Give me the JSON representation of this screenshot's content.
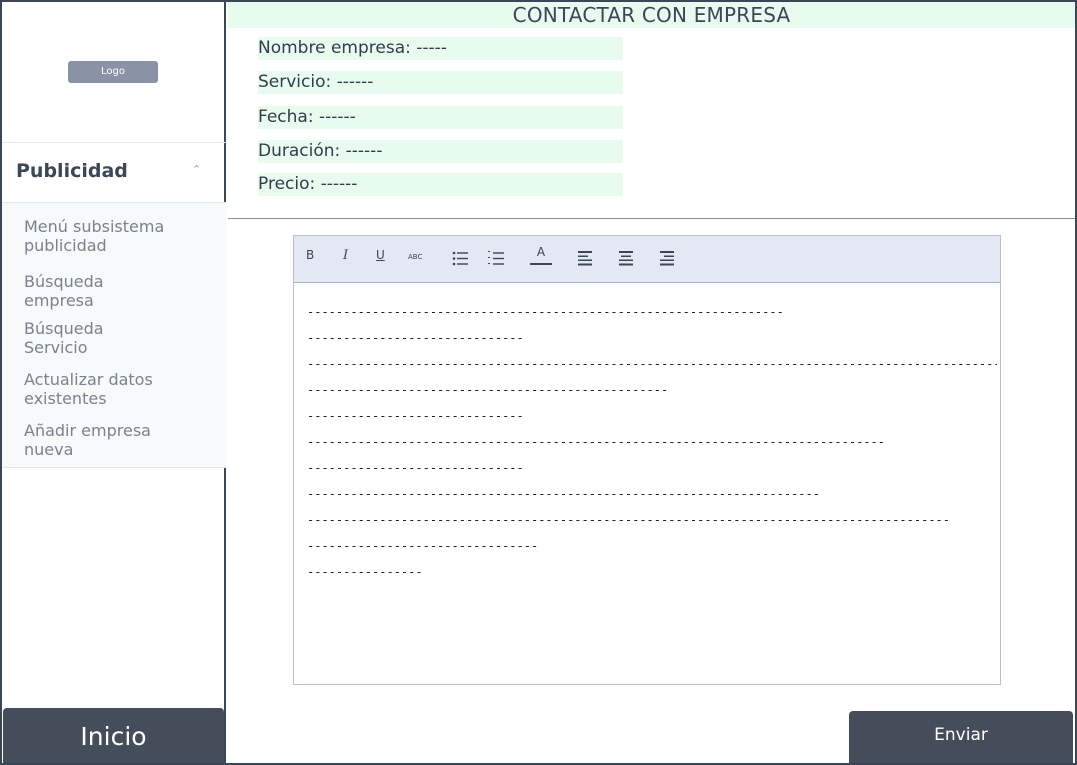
{
  "sidebar": {
    "logo_label": "Logo",
    "section_title": "Publicidad",
    "items": [
      {
        "label": "Menú subsistema\npublicidad"
      },
      {
        "label": "Búsqueda\nempresa"
      },
      {
        "label": "Búsqueda\nServicio"
      },
      {
        "label": "Actualizar datos\nexistentes"
      },
      {
        "label": "Añadir empresa\nnueva"
      }
    ],
    "home_button": "Inicio"
  },
  "main": {
    "title": "CONTACTAR CON EMPRESA",
    "fields": [
      {
        "label": "Nombre empresa: -----"
      },
      {
        "label": "Servicio: ------"
      },
      {
        "label": "Fecha: ------"
      },
      {
        "label": "Duración: ------"
      },
      {
        "label": "Precio: ------"
      }
    ],
    "editor": {
      "toolbar": {
        "bold": "B",
        "italic": "I",
        "underline": "U",
        "strikethrough": "ABC",
        "font_color": "A"
      },
      "lines": [
        "------------------------------------------------------------------",
        "------------------------------",
        "----------------------------------------------------------------------------------------------------",
        "--------------------------------------------------",
        "------------------------------",
        "--------------------------------------------------------------------------------",
        "------------------------------",
        "-----------------------------------------------------------------------",
        "-----------------------------------------------------------------------------------------",
        "--------------------------------",
        "----------------"
      ]
    },
    "send_button": "Enviar"
  }
}
